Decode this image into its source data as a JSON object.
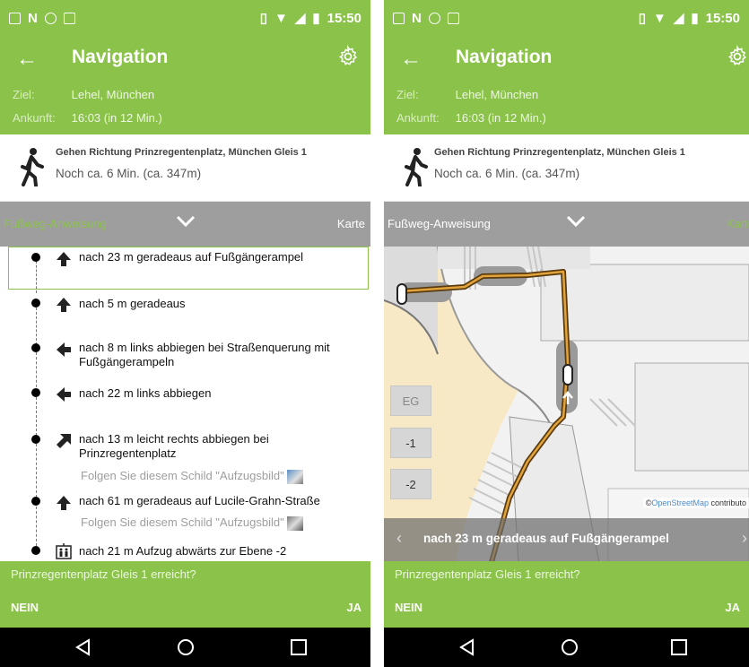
{
  "status_bar": {
    "time": "15:50"
  },
  "app": {
    "title": "Navigation",
    "destination_label": "Ziel:",
    "destination_value": "Lehel, München",
    "arrival_label": "Ankunft:",
    "arrival_value": "16:03 (in 12 Min.)"
  },
  "walk": {
    "instruction": "Gehen Richtung Prinzregentenplatz, München Gleis 1",
    "remaining": "Noch ca. 6 Min. (ca. 347m)"
  },
  "tabs": {
    "left": "Fußweg-Anweisung",
    "right": "Karte"
  },
  "steps": [
    {
      "text": "nach 23 m geradeaus auf Fußgängerampel",
      "icon": "arrow-up-icon"
    },
    {
      "text": "nach 5 m geradeaus",
      "icon": "arrow-up-icon"
    },
    {
      "text": "nach 8 m links abbiegen bei Straßenquerung mit Fußgängerampeln",
      "icon": "arrow-left-icon"
    },
    {
      "text": "nach 22 m links abbiegen",
      "icon": "arrow-left-icon"
    },
    {
      "text": "nach 13 m leicht rechts abbiegen bei Prinzregentenplatz",
      "icon": "arrow-up-right-icon",
      "hint": "Folgen Sie diesem Schild \"Aufzugsbild\""
    },
    {
      "text": "nach 61 m geradeaus auf Lucile-Grahn-Straße",
      "icon": "arrow-up-icon",
      "hint": "Folgen Sie diesem Schild \"Aufzugsbild\""
    },
    {
      "text": "nach 21 m Aufzug abwärts zur Ebene -2",
      "icon": "elevator-icon"
    }
  ],
  "map": {
    "floors": [
      "EG",
      "-1",
      "-2"
    ],
    "attribution_prefix": "©",
    "attribution_link": "OpenStreetMap",
    "attribution_suffix": " contributo",
    "banner": "nach 23 m geradeaus auf Fußgängerampel"
  },
  "confirm": {
    "question": "Prinzregentenplatz Gleis 1 erreicht?",
    "no": "NEIN",
    "yes": "JA"
  },
  "colors": {
    "primary": "#8bc34a",
    "tabbar": "#9e9e9e"
  }
}
